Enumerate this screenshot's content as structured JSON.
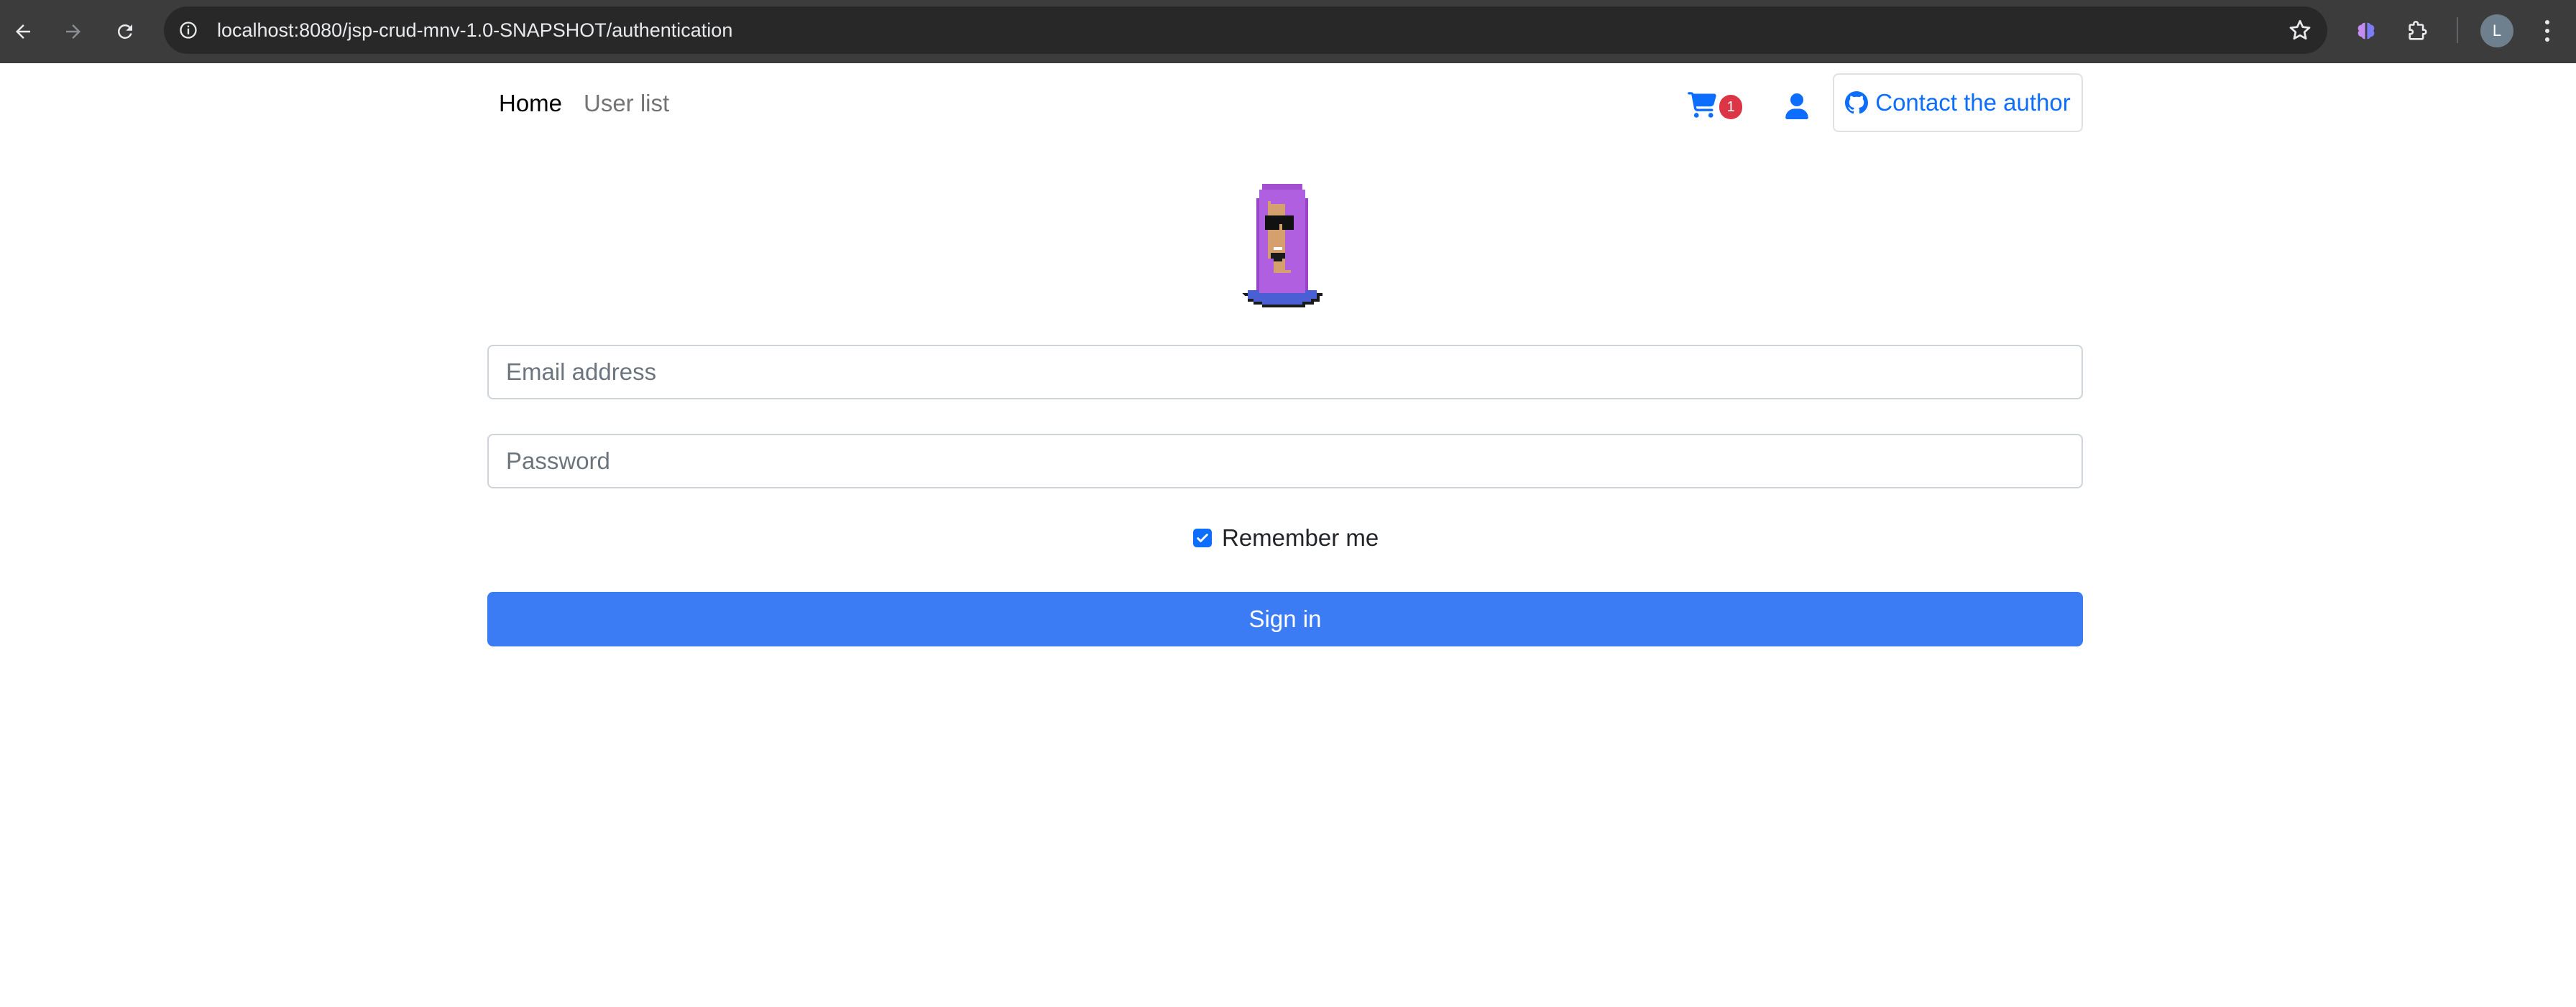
{
  "browser": {
    "url": "localhost:8080/jsp-crud-mnv-1.0-SNAPSHOT/authentication",
    "profile_initial": "L",
    "icons": {
      "back": "arrow-left-icon",
      "forward": "arrow-right-icon",
      "reload": "reload-icon",
      "site_info": "info-icon",
      "bookmark": "star-icon",
      "extension_1": "brain-extension-icon",
      "extension_2": "puzzle-icon",
      "menu": "kebab-menu-icon"
    }
  },
  "navbar": {
    "home_label": "Home",
    "users_label": "User list",
    "cart_count": "1",
    "contact_label": "Contact the author"
  },
  "login": {
    "email_placeholder": "Email address",
    "password_placeholder": "Password",
    "remember_label": "Remember me",
    "remember_checked": true,
    "signin_label": "Sign in"
  },
  "colors": {
    "primary": "#0d6efd",
    "signin_bg": "#3b7cf4",
    "badge": "#dc3545",
    "chrome_bg": "#3c3c3c",
    "omnibox_bg": "#282828"
  }
}
